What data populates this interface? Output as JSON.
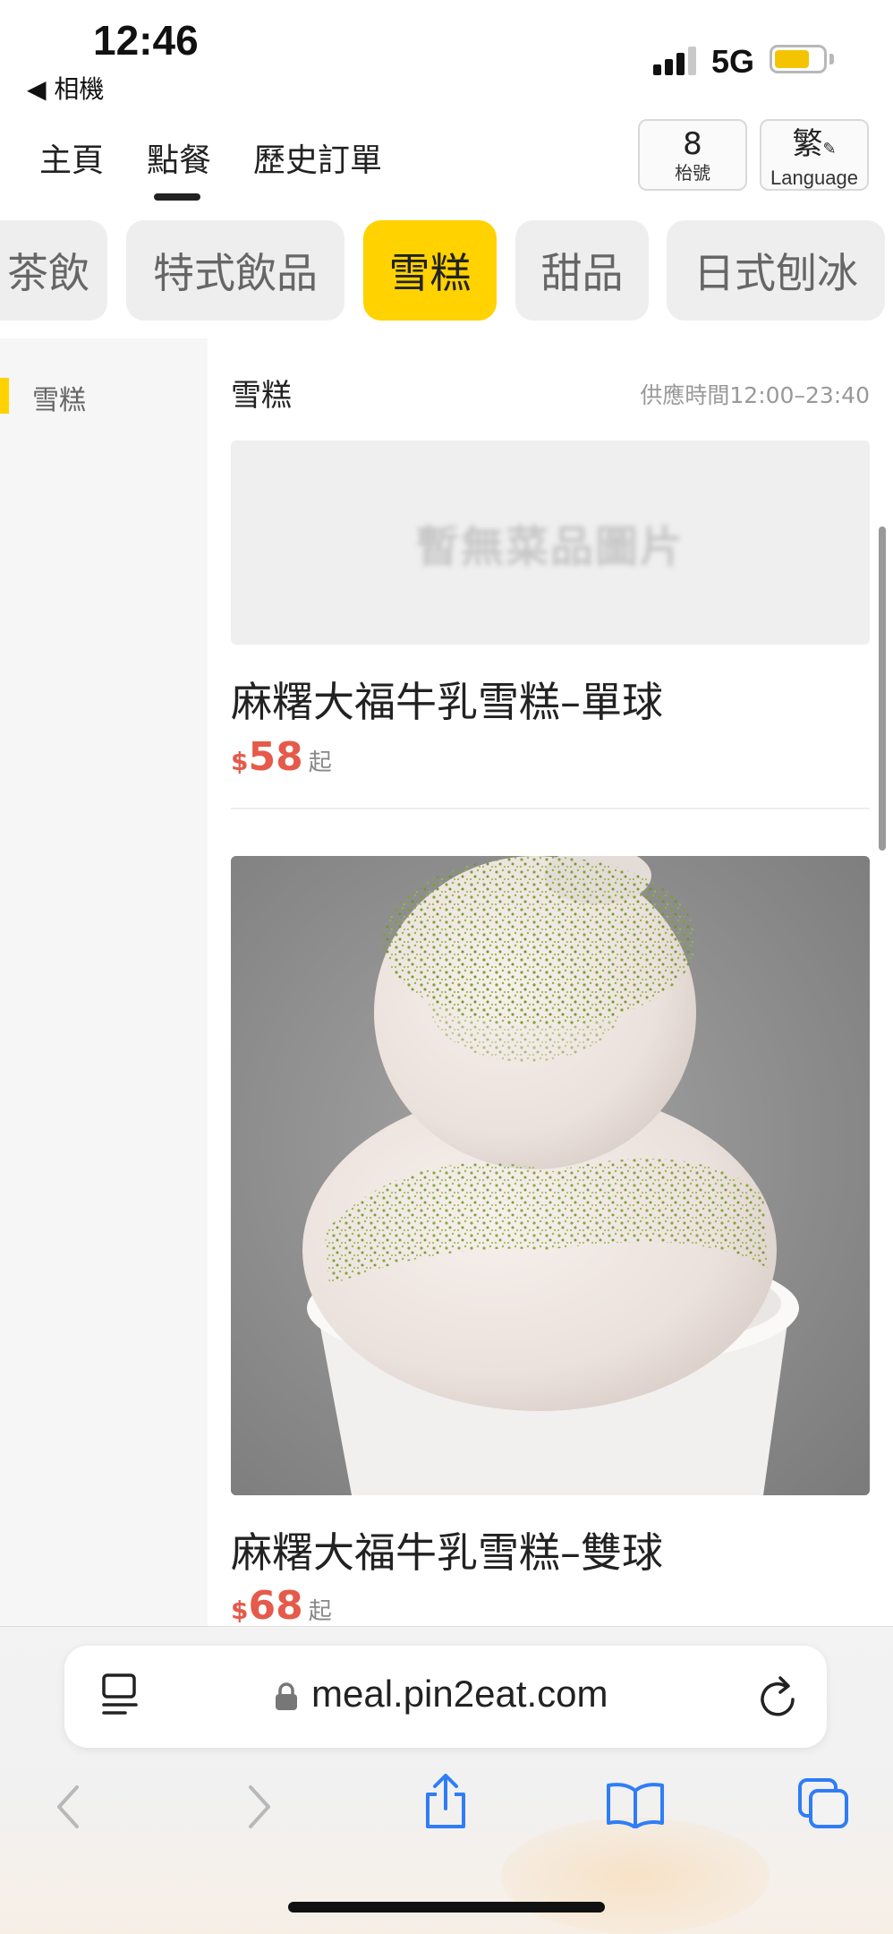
{
  "status_bar": {
    "time": "12:46",
    "back_app": "◀ 相機",
    "network": "5G",
    "battery_level": 0.75,
    "battery_color": "#f5c400"
  },
  "nav": {
    "tabs": [
      {
        "label": "主頁",
        "active": false
      },
      {
        "label": "點餐",
        "active": true
      },
      {
        "label": "歷史訂單",
        "active": false
      }
    ],
    "table": {
      "number": "8",
      "unit": "枱號"
    },
    "language": {
      "char": "繁",
      "label": "Language",
      "icon": "pencil-icon"
    }
  },
  "categories": [
    {
      "label": "茶飲",
      "active": false
    },
    {
      "label": "特式飲品",
      "active": false
    },
    {
      "label": "雪糕",
      "active": true
    },
    {
      "label": "甜品",
      "active": false
    },
    {
      "label": "日式刨冰",
      "active": false
    }
  ],
  "sidebar": {
    "items": [
      {
        "label": "雪糕",
        "active": true
      }
    ]
  },
  "section": {
    "title": "雪糕",
    "hours": "供應時間12:00–23:40"
  },
  "items": [
    {
      "image_placeholder": "暫無菜品圖片",
      "name": "麻糬大福牛乳雪糕–單球",
      "currency": "$",
      "price": "58",
      "price_suffix": "起"
    },
    {
      "image": "photo of two-scoop milk ice cream dusted with matcha powder in a paper cup",
      "name": "麻糬大福牛乳雪糕–雙球",
      "currency": "$",
      "price": "68",
      "price_suffix": "起"
    }
  ],
  "browser": {
    "url": "meal.pin2eat.com",
    "toolbar": [
      "back-icon",
      "forward-icon",
      "share-icon",
      "bookmarks-icon",
      "tabs-icon"
    ]
  },
  "colors": {
    "accent": "#ffd200",
    "price": "#e55a4a",
    "ios_blue": "#2f7df6"
  }
}
